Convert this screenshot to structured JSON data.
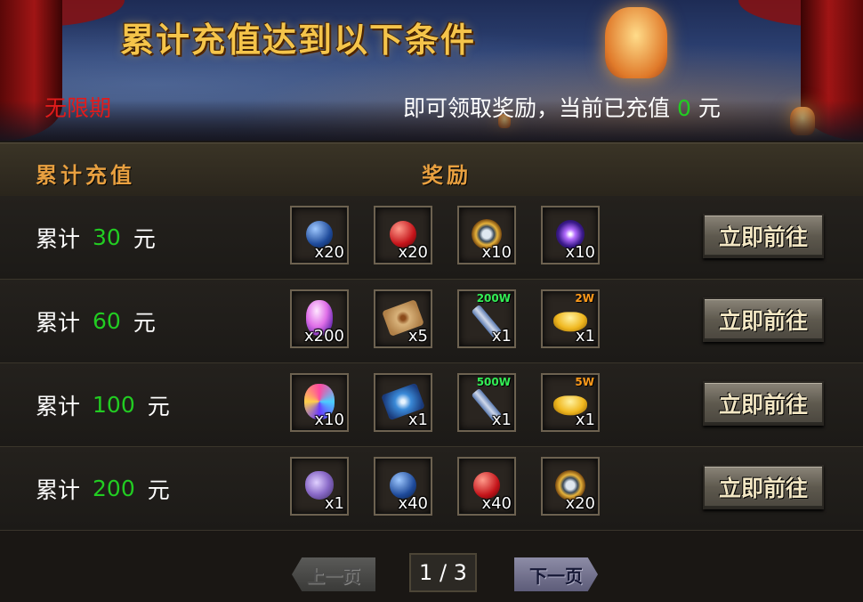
{
  "banner": {
    "title": "累计充值达到以下条件",
    "period": "无限期",
    "status_prefix": "即可领取奖励，当前已充值",
    "current_amount": "0",
    "currency": "元"
  },
  "table": {
    "col_recharge": "累计充值",
    "col_rewards": "奖励"
  },
  "tiers": [
    {
      "prefix": "累计",
      "amount": "30",
      "unit": "元",
      "button": "立即前往",
      "rewards": [
        {
          "icon": "blue-orb-icon",
          "qty": "x20"
        },
        {
          "icon": "red-orb-icon",
          "qty": "x20"
        },
        {
          "icon": "gold-medallion-icon",
          "qty": "x10"
        },
        {
          "icon": "purple-star-orb-icon",
          "qty": "x10"
        }
      ]
    },
    {
      "prefix": "累计",
      "amount": "60",
      "unit": "元",
      "button": "立即前往",
      "rewards": [
        {
          "icon": "pink-crystal-icon",
          "qty": "x200"
        },
        {
          "icon": "ancient-scroll-icon",
          "qty": "x5"
        },
        {
          "icon": "exp-scroll-icon",
          "qty": "x1",
          "tag": "200W",
          "tag_color": "#33ee55"
        },
        {
          "icon": "gold-ingot-icon",
          "qty": "x1",
          "tag": "2W",
          "tag_color": "#ff9a1a"
        }
      ]
    },
    {
      "prefix": "累计",
      "amount": "100",
      "unit": "元",
      "button": "立即前往",
      "rewards": [
        {
          "icon": "rainbow-crystal-icon",
          "qty": "x10"
        },
        {
          "icon": "blue-rune-map-icon",
          "qty": "x1"
        },
        {
          "icon": "exp-scroll-icon",
          "qty": "x1",
          "tag": "500W",
          "tag_color": "#33ee55"
        },
        {
          "icon": "gold-ingot-icon",
          "qty": "x1",
          "tag": "5W",
          "tag_color": "#ff9a1a"
        }
      ]
    },
    {
      "prefix": "累计",
      "amount": "200",
      "unit": "元",
      "button": "立即前往",
      "rewards": [
        {
          "icon": "purple-pouch-icon",
          "qty": "x1"
        },
        {
          "icon": "blue-orb-icon",
          "qty": "x40"
        },
        {
          "icon": "red-orb-icon",
          "qty": "x40"
        },
        {
          "icon": "gold-medallion-icon",
          "qty": "x20"
        }
      ]
    }
  ],
  "pager": {
    "prev": "上一页",
    "next": "下一页",
    "page": "1 / 3"
  }
}
